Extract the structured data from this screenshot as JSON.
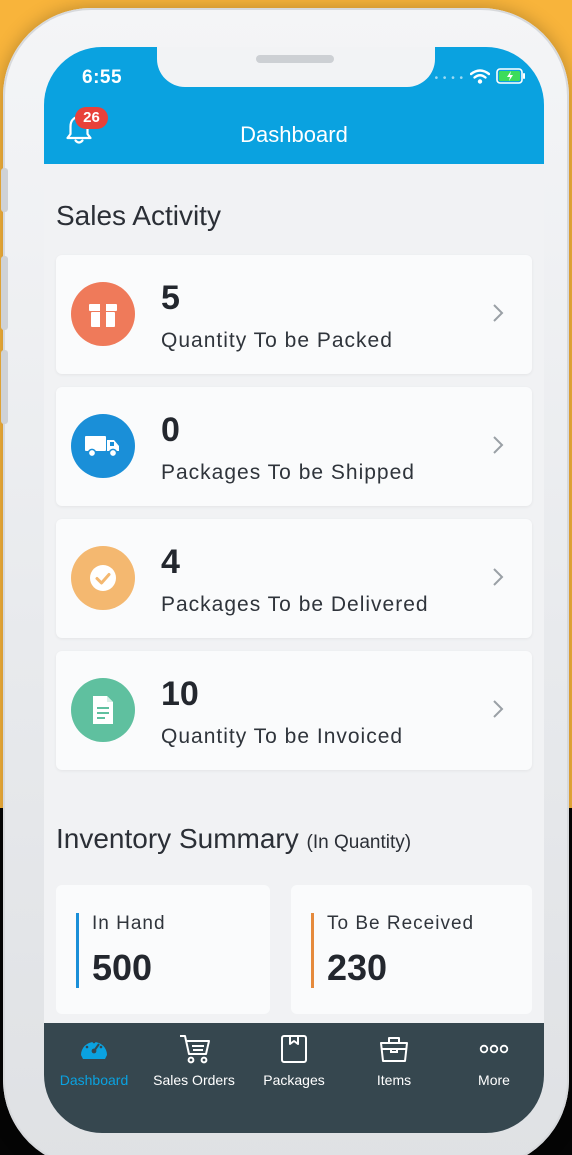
{
  "status_bar": {
    "time": "6:55"
  },
  "header": {
    "title": "Dashboard",
    "notification_count": "26"
  },
  "sales_activity": {
    "title": "Sales Activity",
    "cards": [
      {
        "value": "5",
        "label": "Quantity To be Packed",
        "icon": "package-icon",
        "color": "#ef7a5a"
      },
      {
        "value": "0",
        "label": "Packages To be Shipped",
        "icon": "truck-icon",
        "color": "#1a8fd8"
      },
      {
        "value": "4",
        "label": "Packages To be Delivered",
        "icon": "check-circle-icon",
        "color": "#f4b870"
      },
      {
        "value": "10",
        "label": "Quantity To be Invoiced",
        "icon": "document-icon",
        "color": "#5fc09f"
      }
    ]
  },
  "inventory_summary": {
    "title": "Inventory Summary",
    "subtitle": "(In Quantity)",
    "in_hand": {
      "label": "In Hand",
      "value": "500",
      "accent": "#1a8fd8"
    },
    "to_receive": {
      "label": "To Be Received",
      "value": "230",
      "accent": "#e58a3c"
    }
  },
  "tabbar": {
    "tabs": [
      {
        "label": "Dashboard",
        "icon": "speedometer-icon",
        "active": true,
        "color": "#0aa2e0"
      },
      {
        "label": "Sales Orders",
        "icon": "cart-icon",
        "active": false,
        "color": "#ffffff"
      },
      {
        "label": "Packages",
        "icon": "box-icon",
        "active": false,
        "color": "#ffffff"
      },
      {
        "label": "Items",
        "icon": "basket-icon",
        "active": false,
        "color": "#ffffff"
      },
      {
        "label": "More",
        "icon": "more-dots-icon",
        "active": false,
        "color": "#ffffff"
      }
    ]
  },
  "colors": {
    "header": "#0aa2e0",
    "background": "#f1f2f4",
    "tabbar": "#36474f",
    "badge": "#e8413a"
  }
}
